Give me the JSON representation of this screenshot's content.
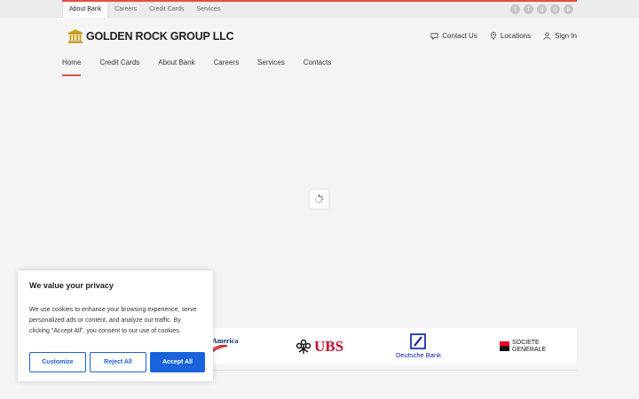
{
  "topbar": {
    "links": [
      "About Bank",
      "Careers",
      "Credit Cards",
      "Services"
    ],
    "socials": [
      "twitter-icon",
      "facebook-icon",
      "googleplus-icon",
      "instagram-icon",
      "pinterest-icon"
    ],
    "accent_color": "#e74c3c"
  },
  "logo": {
    "text": "GOLDEN ROCK GROUP LLC",
    "color": "#d4a017"
  },
  "header": {
    "contact_label": "Contact Us",
    "locations_label": "Locations",
    "signin_label": "Sign In"
  },
  "nav": {
    "items": [
      "Home",
      "Credit Cards",
      "About Bank",
      "Careers",
      "Services",
      "Contacts"
    ],
    "active": "Home"
  },
  "partners": {
    "boa_text": "America",
    "ubs_text": "UBS",
    "deutsche_text": "Deutsche Bank",
    "socgen_line1": "SOCIETE",
    "socgen_line2": "GENERALE"
  },
  "cookie": {
    "title": "We value your privacy",
    "text": "We use cookies to enhance your browsing experience, serve personalized ads or content, and analyze our traffic. By clicking \"Accept All\", you consent to our use of cookies.",
    "customize_label": "Customize",
    "reject_label": "Reject All",
    "accept_label": "Accept All",
    "button_color": "#1863dc"
  }
}
